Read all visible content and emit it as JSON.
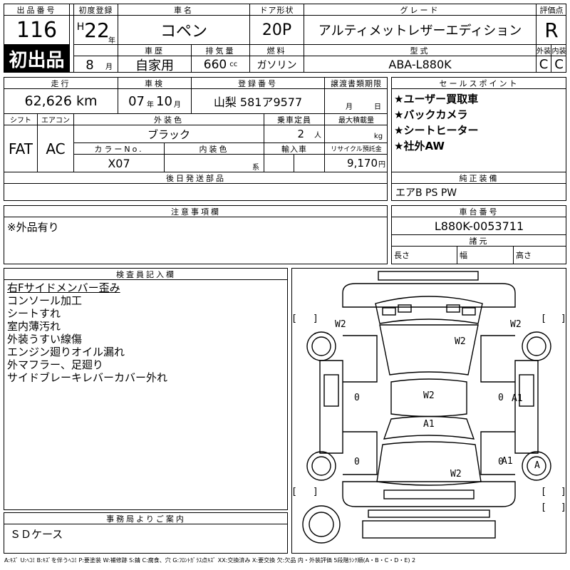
{
  "header": {
    "lot_label": "出品番号",
    "lot_value": "116",
    "first_reg_label": "初度登録",
    "era": "H",
    "year": "22",
    "year_unit": "年",
    "month": "8",
    "month_unit": "月",
    "carname_label": "車名",
    "carname_value": "コペン",
    "door_label": "ドア形状",
    "door_value": "20P",
    "grade_label": "グレード",
    "grade_value": "アルティメットレザーエディション",
    "score_label": "評価点",
    "score_value": "R",
    "first_listing": "初出品",
    "history_label": "車歴",
    "history_value": "自家用",
    "displacement_label": "排気量",
    "displacement_value": "660",
    "displacement_unit": "cc",
    "fuel_label": "燃料",
    "fuel_value": "ガソリン",
    "model_label": "型式",
    "model_value": "ABA-L880K",
    "exterior_label": "外装",
    "exterior_value": "C",
    "interior_label": "内装",
    "interior_value": "C"
  },
  "row2": {
    "mileage_label": "走行",
    "mileage_value": "62,626",
    "mileage_unit": "km",
    "inspection_label": "車検",
    "insp_year": "07",
    "insp_year_unit": "年",
    "insp_month": "10",
    "insp_month_unit": "月",
    "plate_label": "登録番号",
    "plate_value": "山梨 581ア9577",
    "transfer_label": "譲渡書類期限",
    "transfer_month": "月",
    "transfer_day": "日",
    "shift_label": "シフト",
    "shift_value": "FAT",
    "ac_label": "エアコン",
    "ac_value": "AC",
    "color_label": "外装色",
    "color_value": "ブラック",
    "capacity_label": "乗車定員",
    "capacity_value": "2",
    "capacity_unit": "人",
    "load_label": "最大積載量",
    "load_unit": "kg",
    "colorno_label": "カラーNo.",
    "colorno_value": "X07",
    "intcolor_label": "内装色",
    "intcolor_unit": "系",
    "import_label": "輸入車",
    "recycle_label": "リサイクル預託金",
    "recycle_value": "9,170",
    "recycle_unit": "円",
    "later_label": "後日発送部品"
  },
  "sales": {
    "label": "セールスポイント",
    "items": [
      "★ユーザー買取車",
      "★バックカメラ",
      "★シートヒーター",
      "★社外AW"
    ]
  },
  "equipment": {
    "label": "純正装備",
    "value": "エアB PS PW"
  },
  "notes": {
    "label": "注意事項欄",
    "value": "※外品有り"
  },
  "chassis": {
    "label": "車台番号",
    "value": "L880K-0053711"
  },
  "dims": {
    "label": "諸元",
    "length": "長さ",
    "width": "幅",
    "height": "高さ"
  },
  "inspector": {
    "label": "検査員記入欄",
    "lines": [
      "右Fサイドメンバー歪み",
      "コンソール加工",
      "シートすれ",
      "室内薄汚れ",
      "外装うすい線傷",
      "エンジン廻りオイル漏れ",
      "外マフラー、足廻り",
      "サイドブレーキレバーカバー外れ"
    ]
  },
  "office": {
    "label": "事務局よりご案内",
    "value": "ＳＤケース"
  },
  "diagram_marks": {
    "w2_fl": "W2",
    "w2_fr": "W2",
    "w2_hood": "W2",
    "w2_center": "W2",
    "a1_center": "A1",
    "a1_right": "A1",
    "a1_rr": "A1",
    "w2_rear": "W2",
    "a_wheel": "A"
  },
  "legend": "A:ｷｽﾞ U:ﾍｺﾐ B:ｷｽﾞを伴うﾍｺﾐ P:要塗装 W:補修跡 S:錆 C:腐食、穴 G:ﾌﾛﾝﾄｶﾞﾗｽ点ｷｽﾞ XX:交換済み X:要交換 欠:欠品 内・外装評価 5段階ﾗﾝｸ順(A・B・C・D・E) 2"
}
